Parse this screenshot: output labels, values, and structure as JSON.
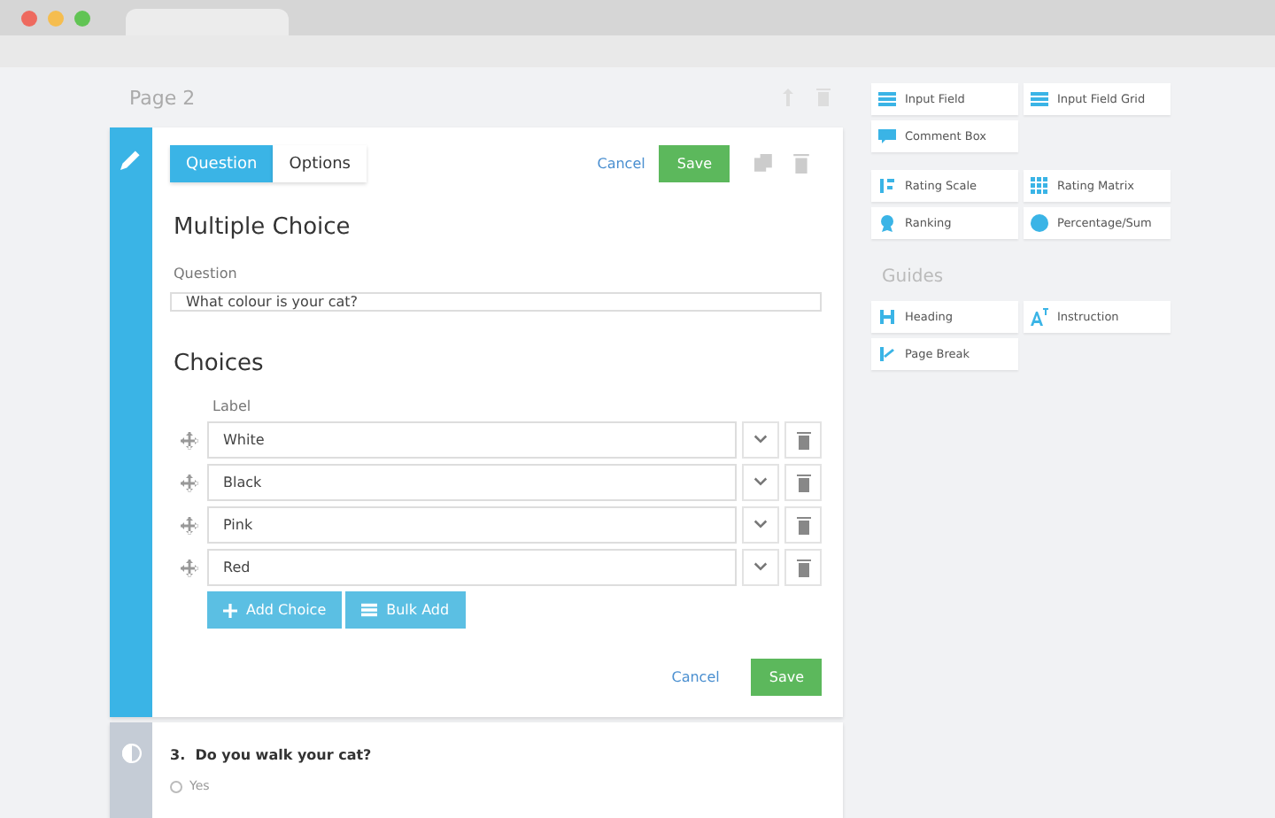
{
  "page": {
    "title": "Page 2"
  },
  "editor": {
    "tabs": [
      {
        "label": "Question",
        "selected": true
      },
      {
        "label": "Options",
        "selected": false
      }
    ],
    "cancel": "Cancel",
    "save": "Save",
    "heading": "Multiple Choice",
    "question_label": "Question",
    "question_value": "What colour is your cat?",
    "choices_heading": "Choices",
    "label_heading": "Label",
    "choices": [
      {
        "value": "White"
      },
      {
        "value": "Black"
      },
      {
        "value": "Pink"
      },
      {
        "value": "Red"
      }
    ],
    "add_choice": "Add Choice",
    "bulk_add": "Bulk Add",
    "footer_cancel": "Cancel",
    "footer_save": "Save"
  },
  "next_question": {
    "number": "3.",
    "text": "Do you walk your cat?",
    "options": [
      {
        "label": "Yes",
        "selected": false
      }
    ]
  },
  "palette": {
    "groups": [
      {
        "items": [
          {
            "label": "Input Field",
            "kind": "lines"
          },
          {
            "label": "Input Field Grid",
            "kind": "lines"
          },
          {
            "label": "Comment Box",
            "kind": "comment"
          }
        ]
      },
      {
        "items": [
          {
            "label": "Rating Scale",
            "kind": "scale"
          },
          {
            "label": "Rating Matrix",
            "kind": "grid"
          },
          {
            "label": "Ranking",
            "kind": "ribbon"
          },
          {
            "label": "Percentage/Sum",
            "kind": "pie"
          }
        ]
      }
    ],
    "guides_title": "Guides",
    "guides": [
      {
        "label": "Heading",
        "kind": "heading"
      },
      {
        "label": "Instruction",
        "kind": "instruction"
      },
      {
        "label": "Page Break",
        "kind": "branch"
      }
    ]
  }
}
